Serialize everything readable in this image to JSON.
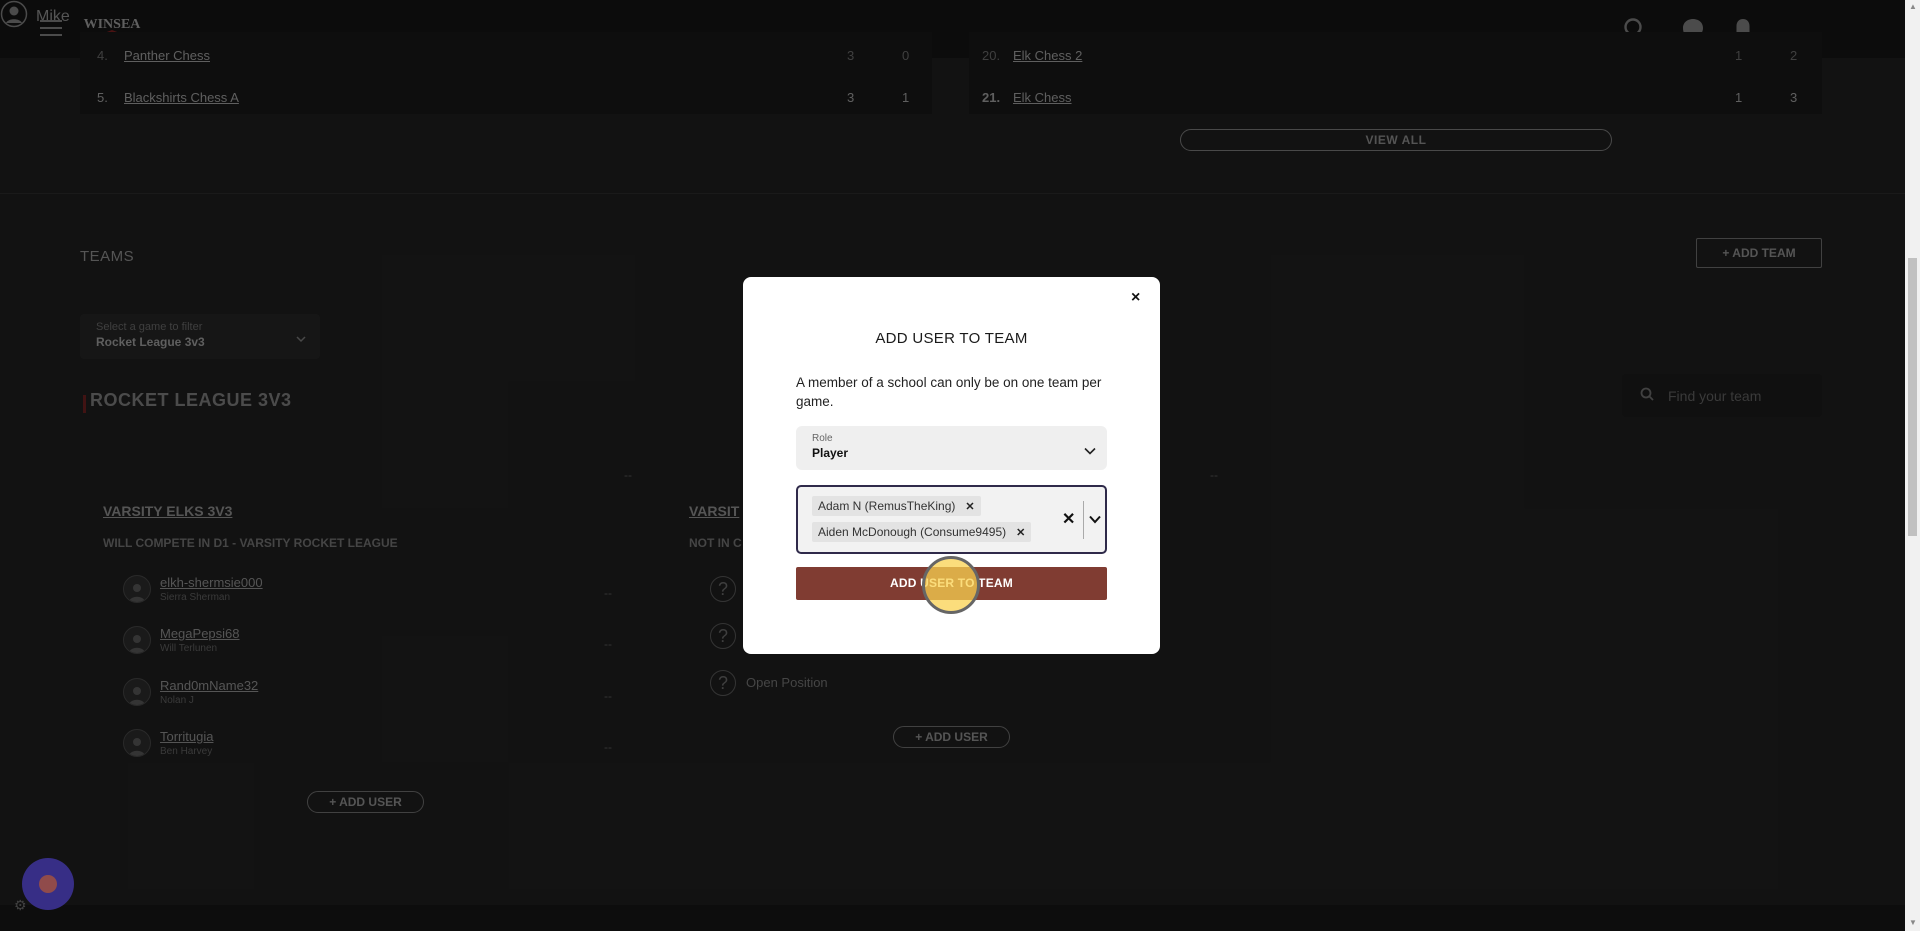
{
  "nav": {
    "logo_text": "WINSEA",
    "user_name": "Mike"
  },
  "standings": {
    "left": {
      "top_rank": "4.",
      "top_team": "Panther Chess",
      "top_w": "3",
      "top_l": "0",
      "row": {
        "rank": "5.",
        "team": "Blackshirts Chess A",
        "w": "3",
        "l": "1"
      }
    },
    "right": {
      "top_rank": "20.",
      "top_team": "Elk Chess 2",
      "top_w": "1",
      "top_l": "2",
      "row": {
        "rank": "21.",
        "team": "Elk Chess",
        "w": "1",
        "l": "3"
      }
    },
    "view_all_label": "VIEW ALL"
  },
  "teams": {
    "title": "TEAMS",
    "add_team_label": "+ ADD TEAM",
    "filter": {
      "label": "Select a game to filter",
      "value": "Rocket League 3v3"
    },
    "section_title": "ROCKET LEAGUE 3V3",
    "search_placeholder": "Find your team",
    "team1": {
      "name": "VARSITY ELKS 3V3",
      "subtitle": "WILL COMPETE IN D1 - VARSITY ROCKET LEAGUE",
      "players": [
        {
          "handle": "elkh-shermsie000",
          "name": "Sierra Sherman",
          "stat": "--"
        },
        {
          "handle": "MegaPepsi68",
          "name": "Will Terlunen",
          "stat": "--"
        },
        {
          "handle": "Rand0mName32",
          "name": "Nolan J",
          "stat": "--"
        },
        {
          "handle": "Torritugia",
          "name": "Ben Harvey",
          "stat": "--"
        }
      ],
      "add_user_label": "+ ADD USER",
      "header_dash": "--"
    },
    "team2": {
      "name_partial": "VARSIT",
      "subtitle_partial": "NOT IN C",
      "open_position_label": "Open Position",
      "add_user_label": "+ ADD USER",
      "header_dash": "--"
    }
  },
  "modal": {
    "title": "ADD USER TO TEAM",
    "description": "A member of a school can only be on one team per game.",
    "role_label": "Role",
    "role_value": "Player",
    "selected_users": [
      "Adam N (RemusTheKing)",
      "Aiden McDonough (Consume9495)"
    ],
    "submit_label": "ADD USER TO TEAM",
    "close_glyph": "×"
  },
  "colors": {
    "accent_button": "#803c32",
    "chat_widget": "#5a4bd8"
  }
}
